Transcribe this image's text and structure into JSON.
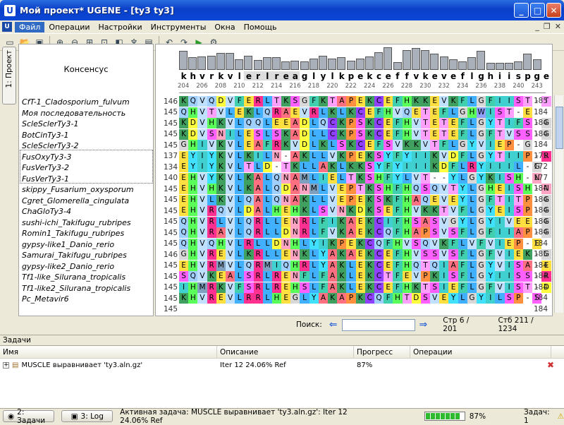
{
  "window": {
    "title": "Мой проект* UGENE - [ty3 ty3]",
    "app_icon": "U"
  },
  "menu": {
    "items": [
      "Файл",
      "Операции",
      "Настройки",
      "Инструменты",
      "Окна",
      "Помощь"
    ]
  },
  "toolbar": {
    "icons": [
      "new-document-icon",
      "open-folder-icon",
      "save-icon",
      "zoom-in-icon",
      "zoom-out-icon",
      "zoom-fit-icon",
      "zoom-to-selection-icon",
      "show-hide-icon",
      "tree-icon",
      "save-alignment-icon",
      "undo-icon",
      "redo-icon",
      "run-icon",
      "options-icon"
    ]
  },
  "sidebar": {
    "project_tab": "1: Проект"
  },
  "alignment": {
    "consensus_label": "Консенсус",
    "consensus": "khvrkvlerlreaglylkpekceffvkeveflghiispge",
    "ruler": [
      "204",
      "206",
      "208",
      "210",
      "212",
      "214",
      "216",
      "218",
      "220",
      "222",
      "224",
      "226",
      "228",
      "230",
      "232",
      "234",
      "236",
      "238",
      "240",
      "243"
    ],
    "histogram": [
      0.78,
      0.52,
      0.55,
      0.58,
      0.72,
      0.72,
      0.45,
      0.58,
      0.42,
      0.52,
      0.52,
      0.35,
      0.38,
      0.35,
      0.46,
      0.58,
      0.48,
      0.52,
      0.38,
      0.46,
      0.55,
      0.75,
      0.95,
      0.32,
      0.82,
      0.9,
      0.82,
      0.68,
      0.55,
      0.45,
      0.34,
      0.52,
      0.78,
      0.28,
      0.3,
      0.28,
      0.35,
      0.68,
      0.45
    ],
    "rows": [
      {
        "name": "CfT-1_Cladosporium_fulvum",
        "start": "146",
        "seq": "KQVQDVFERLTKSGFKTAPEKCEFHKKEVKFLGFIIST-T",
        "end": "185"
      },
      {
        "name": "Моя последовательность",
        "start": "145",
        "seq": "QHVTVLEKLQRAEVRLKLKCEFHVQETEFLGHWIST-E",
        "end": "184"
      },
      {
        "name": "ScleSclerTy3-1",
        "start": "145",
        "seq": "KDVHKVLQQLEEADLQCKPSKCEFHVTETEFLGYTIFS-G",
        "end": "184"
      },
      {
        "name": "BotCinTy3-1",
        "start": "145",
        "seq": "KDVSNILESLSKADLLCKPSKCEFHVTETEFLGFTVSS-G",
        "end": "184"
      },
      {
        "name": "ScleSclerTy3-2",
        "start": "145",
        "seq": "GHIVKVLEAFRKVDLKLSKCEFSVKKVTFLGYVIEP-G",
        "end": "184"
      },
      {
        "name": "FusOxyTy3-3",
        "start": "137",
        "seq": "EYIYKVLKILN-AKLLVKPEKSYFYIIKVDFLGYTIIP-R",
        "end": "175"
      },
      {
        "name": "FusVerTy3-2",
        "start": "134",
        "seq": "EYIYKVLTLD-TKLLAKLKKSYFYIIIKDFLRYIIIL-G",
        "end": "172"
      },
      {
        "name": "FusVerTy3-1",
        "start": "140",
        "seq": "EHVYKVLKALQNAMLIELTKSHFYLVT--YLGYKISH-N",
        "end": "177"
      },
      {
        "name": "skippy_Fusarium_oxysporum",
        "start": "145",
        "seq": "EHVHKVLKALQDANMLVEPTKSHFHQSQVTYLGHEISH-N",
        "end": "184"
      },
      {
        "name": "Cgret_Glomerella_cingulata",
        "start": "145",
        "seq": "EHVLKVLQALQNAKLLVEPEKSKFHAQEVEYLGFTITP-G",
        "end": "184"
      },
      {
        "name": "ChaGloTy3-4",
        "start": "145",
        "seq": "EHVRQVLDALHEHKLSVNKDKSEFHVKKTVFLGYEISP-G",
        "end": "184"
      },
      {
        "name": "sushi-ichi_Takifugu_rubripes",
        "start": "145",
        "seq": "QHVRLVLQRLLENRLFIKAEKCIFHSASVGYLGYIVEE-G",
        "end": "184"
      },
      {
        "name": "Romin1_Takifugu_rubripes",
        "start": "145",
        "seq": "QHVRAVLQRLLDNRLFVKAEKCQFHAPSVSFLGFIIAP-G",
        "end": "184"
      },
      {
        "name": "gypsy-like1_Danio_rerio",
        "start": "145",
        "seq": "QHVQHVLRLLDNHLYIKPEKCQFHVSQVKFLVFVIEP-E",
        "end": "184"
      },
      {
        "name": "Samurai_Takifugu_rubripes",
        "start": "146",
        "seq": "GHVREVLKRLLENKLYAKAEKCEFHVSSVSFLGFVIEK-G",
        "end": "185"
      },
      {
        "name": "gypsy-like2_Danio_rerio",
        "start": "145",
        "seq": "EHVRMVLQRMIQHRLYAKLEKCEFHQTQIAFLGYVISA-E",
        "end": "184"
      },
      {
        "name": "Tf1-like_Silurana_tropicalis",
        "start": "145",
        "seq": "SQVKEALSRLRENFLFAKLEKCTFEVPKISFLGYIISS-R",
        "end": "184"
      },
      {
        "name": "Tf1-like2_Silurana_tropicalis",
        "start": "145",
        "seq": "IHMRKVFSRLREHSLFAKLEKCEFHKTSIEFLGFVIST-D",
        "end": "184"
      },
      {
        "name": "Pc_Metavir6",
        "start": "145",
        "seq": "KHVREVLRRLHEGLYAKAPKCQFHTDSVEYLGYILSP-S",
        "end": "184"
      },
      {
        "name": "",
        "start": "145",
        "seq": "",
        "end": "184"
      }
    ]
  },
  "search": {
    "label": "Поиск:",
    "page": "Стр 6 / 201",
    "column": "Стб 211 / 1234"
  },
  "tasks": {
    "header": "Задачи",
    "columns": [
      "Имя",
      "Описание",
      "Прогресс",
      "Операции"
    ],
    "row": {
      "name": "MUSCLE выравнивает 'ty3.aln.gz'",
      "description": "Iter  12  24.06%  Ref",
      "progress": "87%"
    }
  },
  "status": {
    "tasks_btn": "2: Задачи",
    "log_btn": "3: Log",
    "active": "Активная задача: MUSCLE выравнивает 'ty3.aln.gz': Iter  12  24.06%  Ref",
    "progress": 0.87,
    "progress_text": "87%",
    "task_count": "Задач: 1"
  },
  "colors": {
    "title_blue": "#0a3fc8",
    "selection": "#316ac5"
  }
}
